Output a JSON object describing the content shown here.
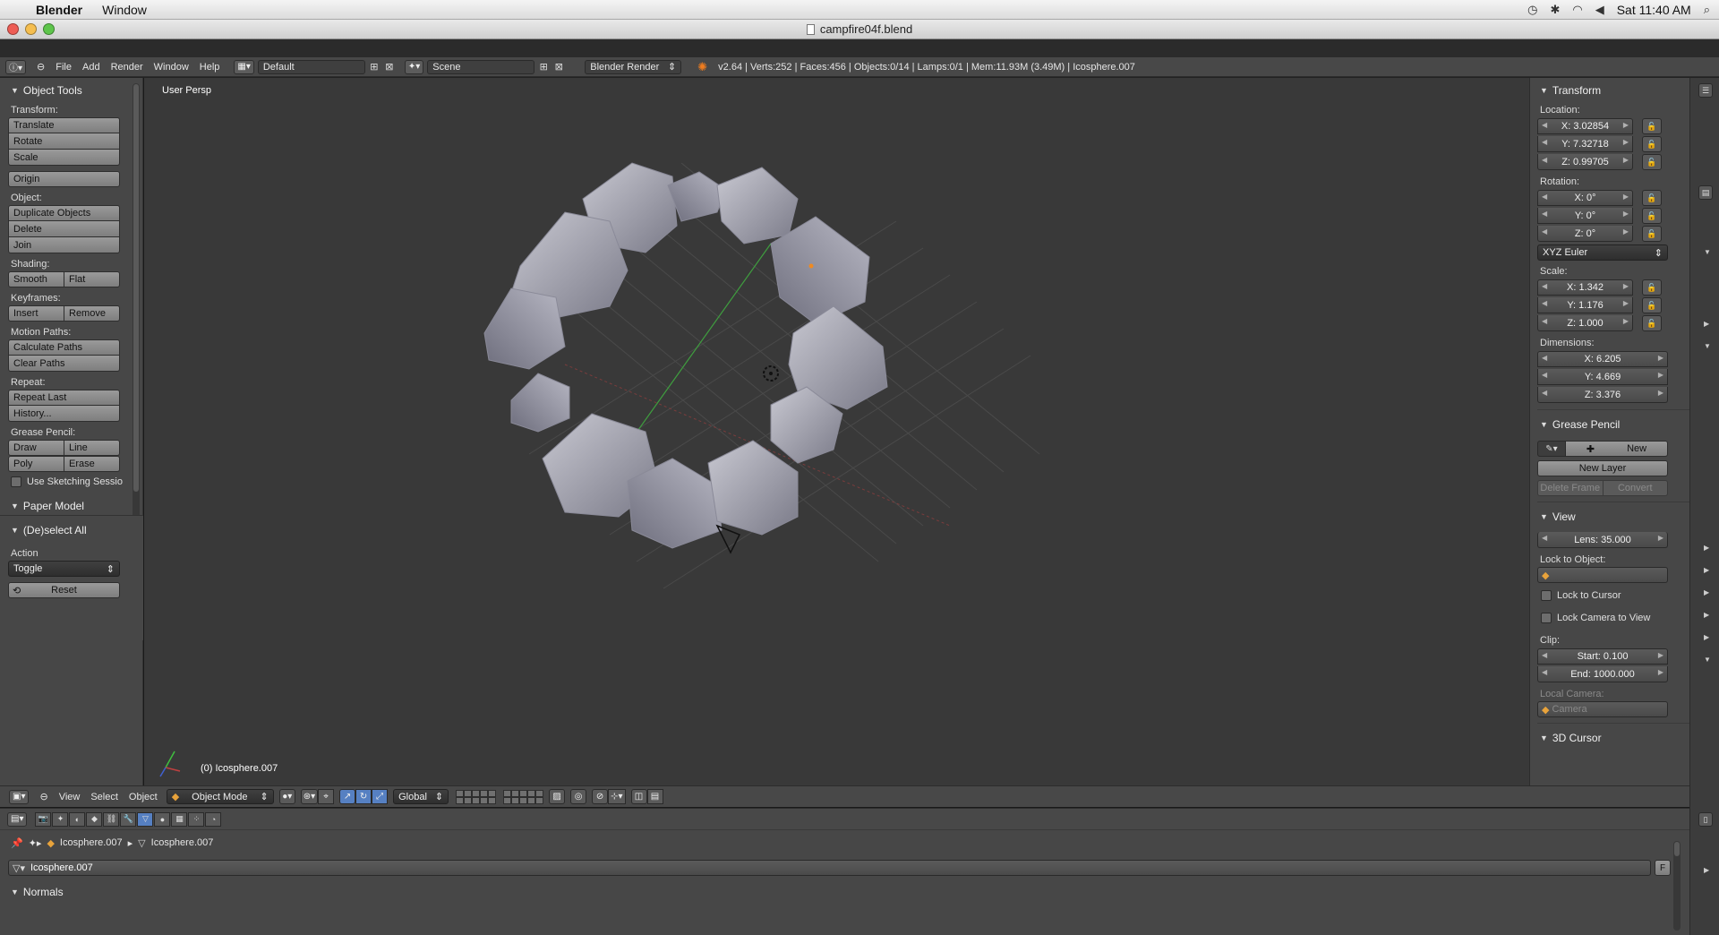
{
  "mac_menubar": {
    "app_name": "Blender",
    "menus": [
      "Window"
    ],
    "clock": "Sat 11:40 AM"
  },
  "window": {
    "title": "campfire04f.blend"
  },
  "info_header": {
    "menus": [
      "File",
      "Add",
      "Render",
      "Window",
      "Help"
    ],
    "screen_layout": "Default",
    "scene": "Scene",
    "render_engine": "Blender Render",
    "stats": "v2.64 | Verts:252 | Faces:456 | Objects:0/14 | Lamps:0/1 | Mem:11.93M (3.49M) | Icosphere.007"
  },
  "tool_shelf": {
    "panel_title": "Object Tools",
    "transform_label": "Transform:",
    "translate": "Translate",
    "rotate": "Rotate",
    "scale": "Scale",
    "origin": "Origin",
    "object_label": "Object:",
    "duplicate": "Duplicate Objects",
    "delete": "Delete",
    "join": "Join",
    "shading_label": "Shading:",
    "smooth": "Smooth",
    "flat": "Flat",
    "keyframes_label": "Keyframes:",
    "insert": "Insert",
    "remove": "Remove",
    "motion_label": "Motion Paths:",
    "calc_paths": "Calculate Paths",
    "clear_paths": "Clear Paths",
    "repeat_label": "Repeat:",
    "repeat_last": "Repeat Last",
    "history": "History...",
    "grease_label": "Grease Pencil:",
    "draw": "Draw",
    "line": "Line",
    "poly": "Poly",
    "erase": "Erase",
    "sketching": "Use Sketching Sessio",
    "paper_model": "Paper Model"
  },
  "operator_panel": {
    "title": "(De)select All",
    "action_label": "Action",
    "action_value": "Toggle",
    "reset": "Reset"
  },
  "viewport": {
    "view_label": "User Persp",
    "object_name": "(0) Icosphere.007"
  },
  "properties": {
    "transform_title": "Transform",
    "location_label": "Location:",
    "loc_x": "X: 3.02854",
    "loc_y": "Y: 7.32718",
    "loc_z": "Z: 0.99705",
    "rotation_label": "Rotation:",
    "rot_x": "X: 0°",
    "rot_y": "Y: 0°",
    "rot_z": "Z: 0°",
    "rotation_mode": "XYZ Euler",
    "scale_label": "Scale:",
    "scale_x": "X: 1.342",
    "scale_y": "Y: 1.176",
    "scale_z": "Z: 1.000",
    "dimensions_label": "Dimensions:",
    "dim_x": "X: 6.205",
    "dim_y": "Y: 4.669",
    "dim_z": "Z: 3.376",
    "grease_title": "Grease Pencil",
    "gp_new": "New",
    "gp_new_layer": "New Layer",
    "gp_delete_frame": "Delete Frame",
    "gp_convert": "Convert",
    "view_title": "View",
    "lens": "Lens: 35.000",
    "lock_object_label": "Lock to Object:",
    "lock_cursor": "Lock to Cursor",
    "lock_camera": "Lock Camera to View",
    "clip_label": "Clip:",
    "clip_start": "Start: 0.100",
    "clip_end": "End: 1000.000",
    "local_camera_label": "Local Camera:",
    "local_camera": "Camera",
    "cursor_title": "3D Cursor"
  },
  "vp_header": {
    "view": "View",
    "select": "Select",
    "object": "Object",
    "mode": "Object Mode",
    "orientation": "Global"
  },
  "bottom": {
    "crumb_object": "Icosphere.007",
    "crumb_mesh": "Icosphere.007",
    "mesh_name": "Icosphere.007",
    "fake_user": "F",
    "normals_title": "Normals"
  },
  "colors": {
    "accent_blue": "#5680c2",
    "blender_orange": "#f07d1f",
    "rock": "#9a9aa6"
  }
}
